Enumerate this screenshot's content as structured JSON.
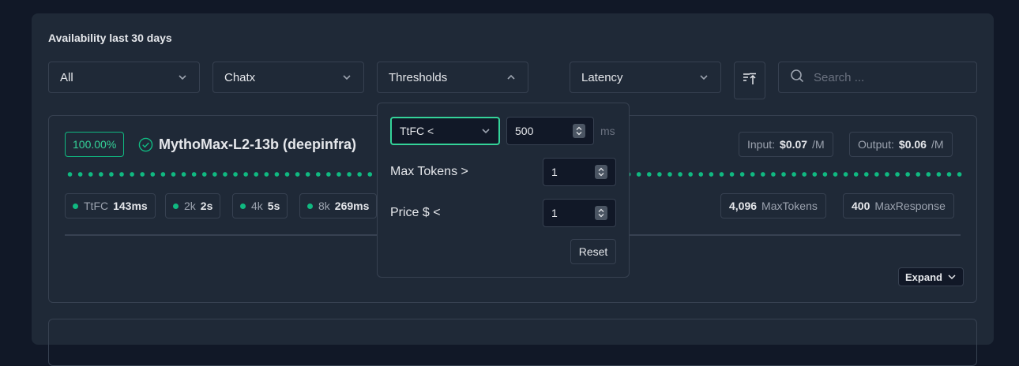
{
  "section_title": "Availability last 30 days",
  "filters": {
    "provider": "All",
    "type": "Chatx",
    "thresholds": "Thresholds",
    "sort": "Latency"
  },
  "search": {
    "placeholder": "Search ..."
  },
  "card": {
    "uptime": "100.00%",
    "model_name": "MythoMax-L2-13b (deepinfra)",
    "input_label": "Input:",
    "input_price": "$0.07",
    "input_unit": "/M",
    "output_label": "Output:",
    "output_price": "$0.06",
    "output_unit": "/M",
    "metrics": [
      {
        "label": "TtFC",
        "value": "143ms"
      },
      {
        "label": "2k",
        "value": "2s"
      },
      {
        "label": "4k",
        "value": "5s"
      },
      {
        "label": "8k",
        "value": "269ms"
      }
    ],
    "max_tokens_value": "4,096",
    "max_tokens_label": "MaxTokens",
    "max_response_value": "400",
    "max_response_label": "MaxResponse",
    "expand_label": "Expand"
  },
  "thresholds_popover": {
    "metric_select": "TtFC <",
    "metric_value": "500",
    "metric_unit": "ms",
    "max_tokens_label": "Max Tokens >",
    "max_tokens_value": "1",
    "price_label": "Price $ <",
    "price_value": "1",
    "reset_label": "Reset"
  },
  "colors": {
    "accent": "#10b981",
    "background": "#111827",
    "panel": "#1f2937",
    "border": "#374151"
  }
}
